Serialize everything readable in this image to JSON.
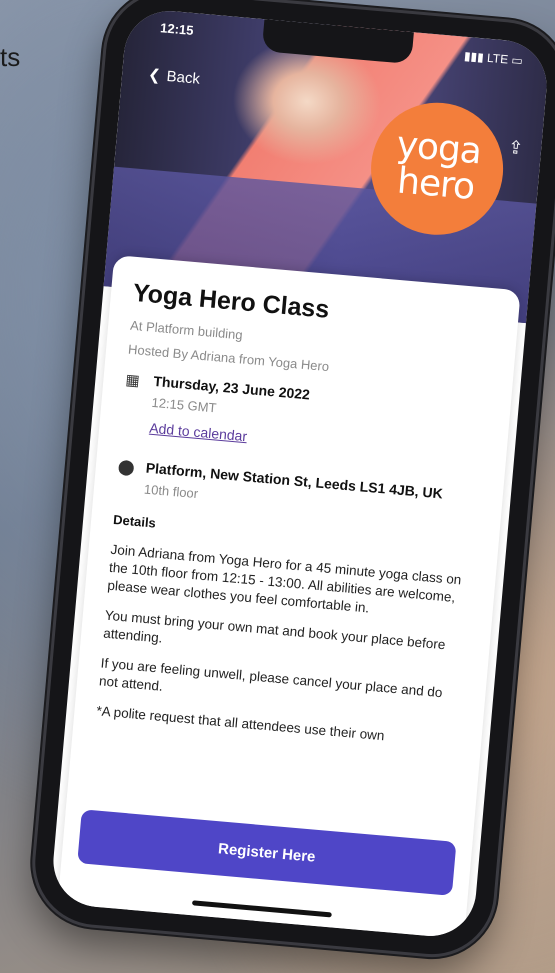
{
  "background": {
    "partial_text": "ts"
  },
  "status_bar": {
    "time": "12:15",
    "carrier": "LTE"
  },
  "nav": {
    "back_label": "Back"
  },
  "hero": {
    "logo_line1": "yoga",
    "logo_line2": "hero",
    "accent_color": "#f37e3b"
  },
  "event": {
    "title": "Yoga Hero Class",
    "venue": "At Platform building",
    "host": "Hosted By Adriana from Yoga Hero",
    "date": "Thursday, 23 June 2022",
    "time": "12:15 GMT",
    "add_calendar": "Add to calendar",
    "address": "Platform, New Station St, Leeds LS1 4JB, UK",
    "floor": "10th floor"
  },
  "details": {
    "heading": "Details",
    "paragraphs": [
      "Join Adriana from Yoga Hero for a 45 minute yoga class on the 10th floor from 12:15 - 13:00. All abilities are welcome, please wear clothes you feel comfortable in.",
      "You must bring your own mat and book your place before attending.",
      "If you are feeling unwell, please cancel your place and do not attend.",
      "*A polite request that all attendees use their own"
    ]
  },
  "cta": {
    "register_label": "Register Here",
    "color": "#4f46c7"
  }
}
